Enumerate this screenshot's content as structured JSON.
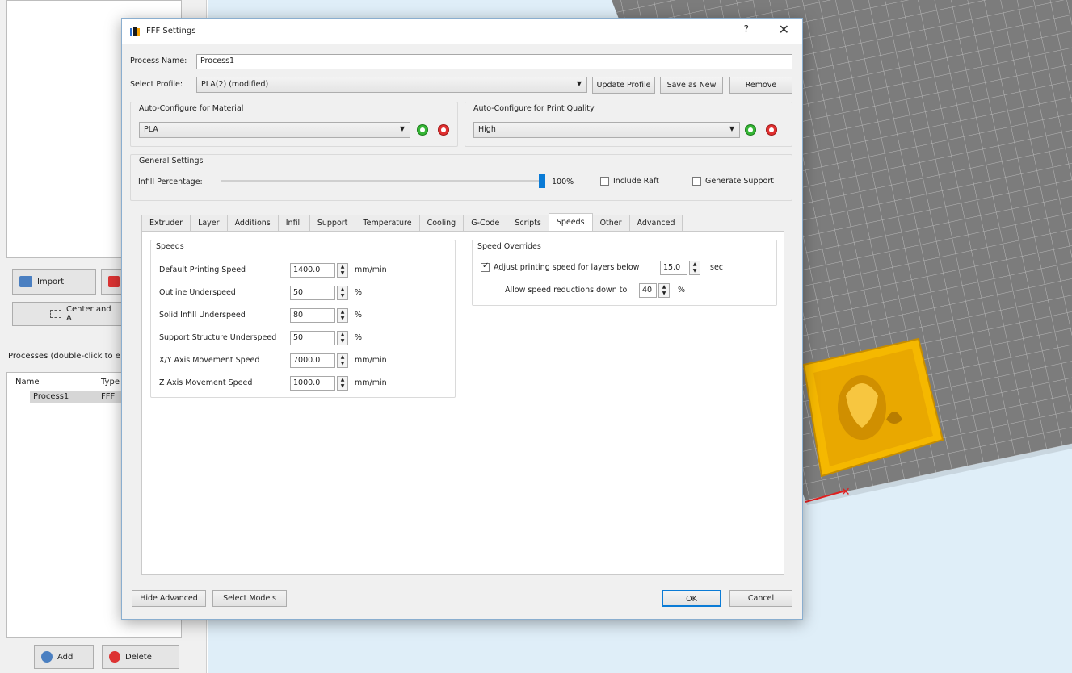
{
  "left_panel": {
    "import_label": "Import",
    "center_label": "Center and A",
    "processes_label": "Processes (double-click to e",
    "list_headers": [
      "Name",
      "Type"
    ],
    "process_row": {
      "name": "Process1",
      "type": "FFF"
    },
    "add_label": "Add",
    "delete_label": "Delete"
  },
  "dialog": {
    "title": "FFF Settings",
    "help": "?",
    "close": "✕",
    "process_name_label": "Process Name:",
    "process_name_value": "Process1",
    "select_profile_label": "Select Profile:",
    "select_profile_value": "PLA(2) (modified)",
    "update_profile": "Update Profile",
    "save_as_new": "Save as New",
    "remove": "Remove",
    "material_group": "Auto-Configure for Material",
    "material_value": "PLA",
    "quality_group": "Auto-Configure for Print Quality",
    "quality_value": "High",
    "general_group": "General Settings",
    "infill_label": "Infill Percentage:",
    "infill_value_text": "100%",
    "infill_fraction": 1.0,
    "include_raft": "Include Raft",
    "generate_support": "Generate Support",
    "tabs": [
      "Extruder",
      "Layer",
      "Additions",
      "Infill",
      "Support",
      "Temperature",
      "Cooling",
      "G-Code",
      "Scripts",
      "Speeds",
      "Other",
      "Advanced"
    ],
    "active_tab": "Speeds",
    "speeds": {
      "group": "Speeds",
      "rows": [
        {
          "label": "Default Printing Speed",
          "value": "1400.0",
          "unit": "mm/min"
        },
        {
          "label": "Outline Underspeed",
          "value": "50",
          "unit": "%"
        },
        {
          "label": "Solid Infill Underspeed",
          "value": "80",
          "unit": "%"
        },
        {
          "label": "Support Structure Underspeed",
          "value": "50",
          "unit": "%"
        },
        {
          "label": "X/Y Axis Movement Speed",
          "value": "7000.0",
          "unit": "mm/min"
        },
        {
          "label": "Z Axis Movement Speed",
          "value": "1000.0",
          "unit": "mm/min"
        }
      ]
    },
    "overrides": {
      "group": "Speed Overrides",
      "adjust_label": "Adjust printing speed for layers below",
      "adjust_value": "15.0",
      "adjust_unit": "sec",
      "allow_label": "Allow speed reductions down to",
      "allow_value": "40",
      "allow_unit": "%"
    },
    "hide_advanced": "Hide Advanced",
    "select_models": "Select Models",
    "ok": "OK",
    "cancel": "Cancel"
  },
  "colors": {
    "accent": "#0a7bd6",
    "model": "#f5b800",
    "viewport_bg": "#dfeef8",
    "grid": "#5a5a5a"
  }
}
